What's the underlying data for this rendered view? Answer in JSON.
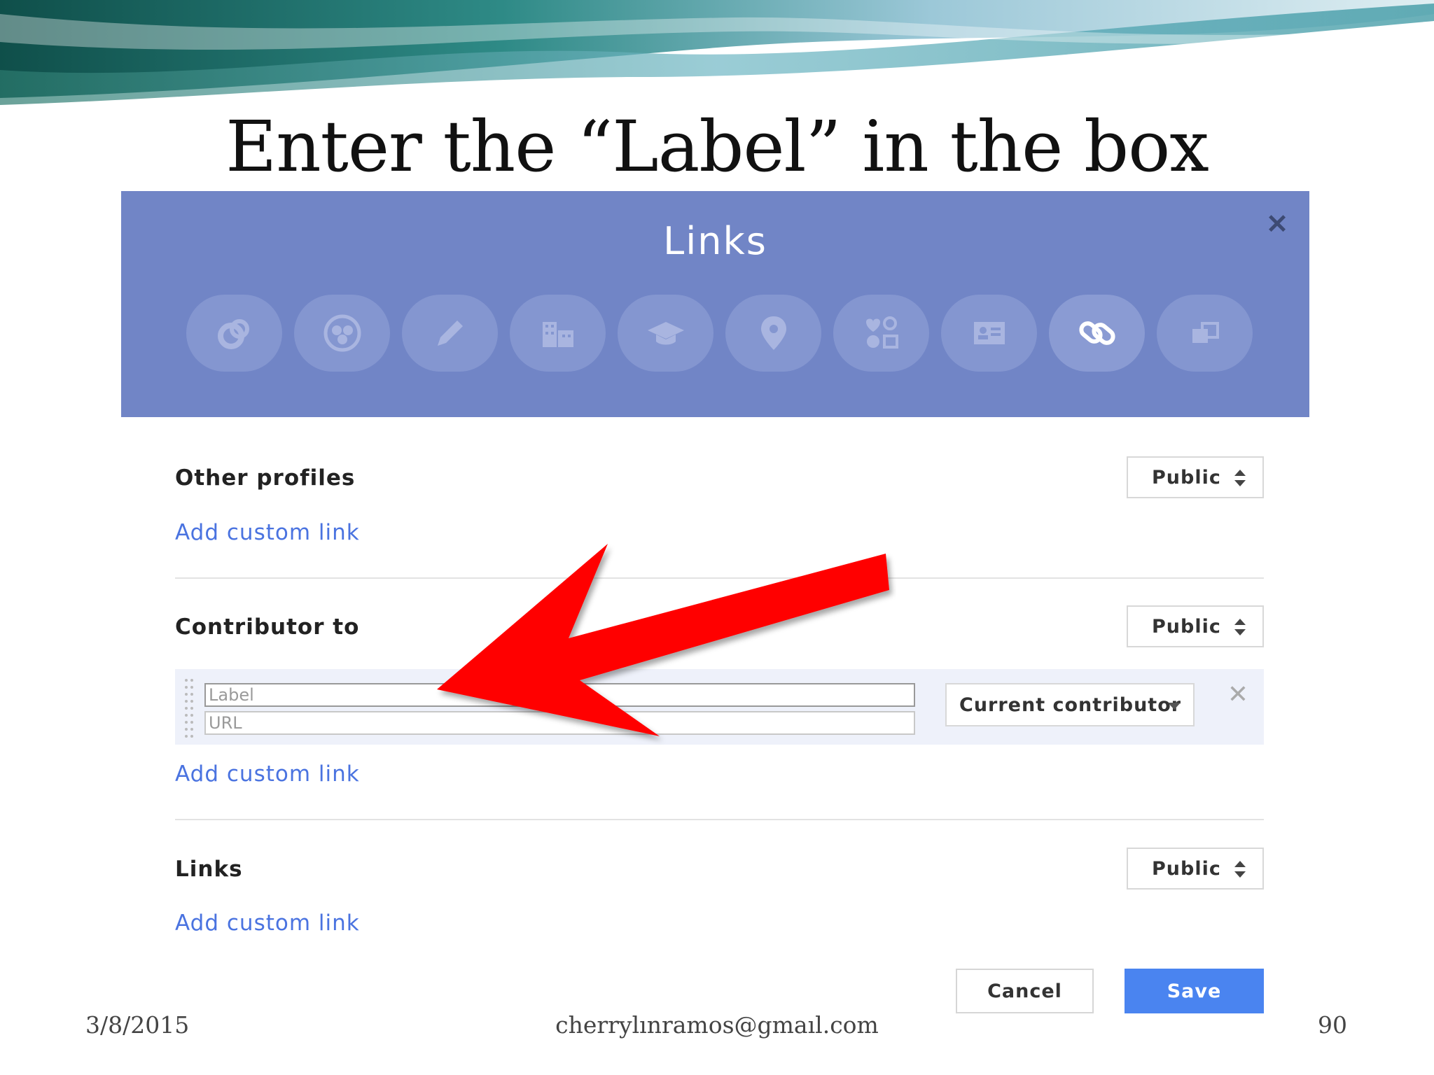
{
  "slide": {
    "title": "Enter the “Label” in the box",
    "footer_date": "3/8/2015",
    "footer_email": "cherrylınramos@gmaıl.com",
    "page_number": "90"
  },
  "dialog": {
    "title": "Links",
    "category_icons": [
      "google-plus-icon",
      "circles-icon",
      "pencil-icon",
      "building-icon",
      "graduation-cap-icon",
      "location-pin-icon",
      "basic-info-icon",
      "contact-card-icon",
      "link-icon",
      "more-icon"
    ],
    "active_icon_index": 8,
    "sections": {
      "other_profiles": {
        "label": "Other profiles",
        "visibility": "Public",
        "add_link": "Add custom link"
      },
      "contributor_to": {
        "label": "Contributor to",
        "visibility": "Public",
        "label_placeholder": "Label",
        "url_placeholder": "URL",
        "contributor_status": "Current contributor",
        "add_link": "Add custom link"
      },
      "links": {
        "label": "Links",
        "visibility": "Public",
        "add_link": "Add custom link"
      }
    },
    "buttons": {
      "cancel": "Cancel",
      "save": "Save"
    }
  },
  "colors": {
    "header": "#7185c6",
    "link": "#4a73e0",
    "save_button": "#4a84f0",
    "arrow": "#ff0000"
  }
}
